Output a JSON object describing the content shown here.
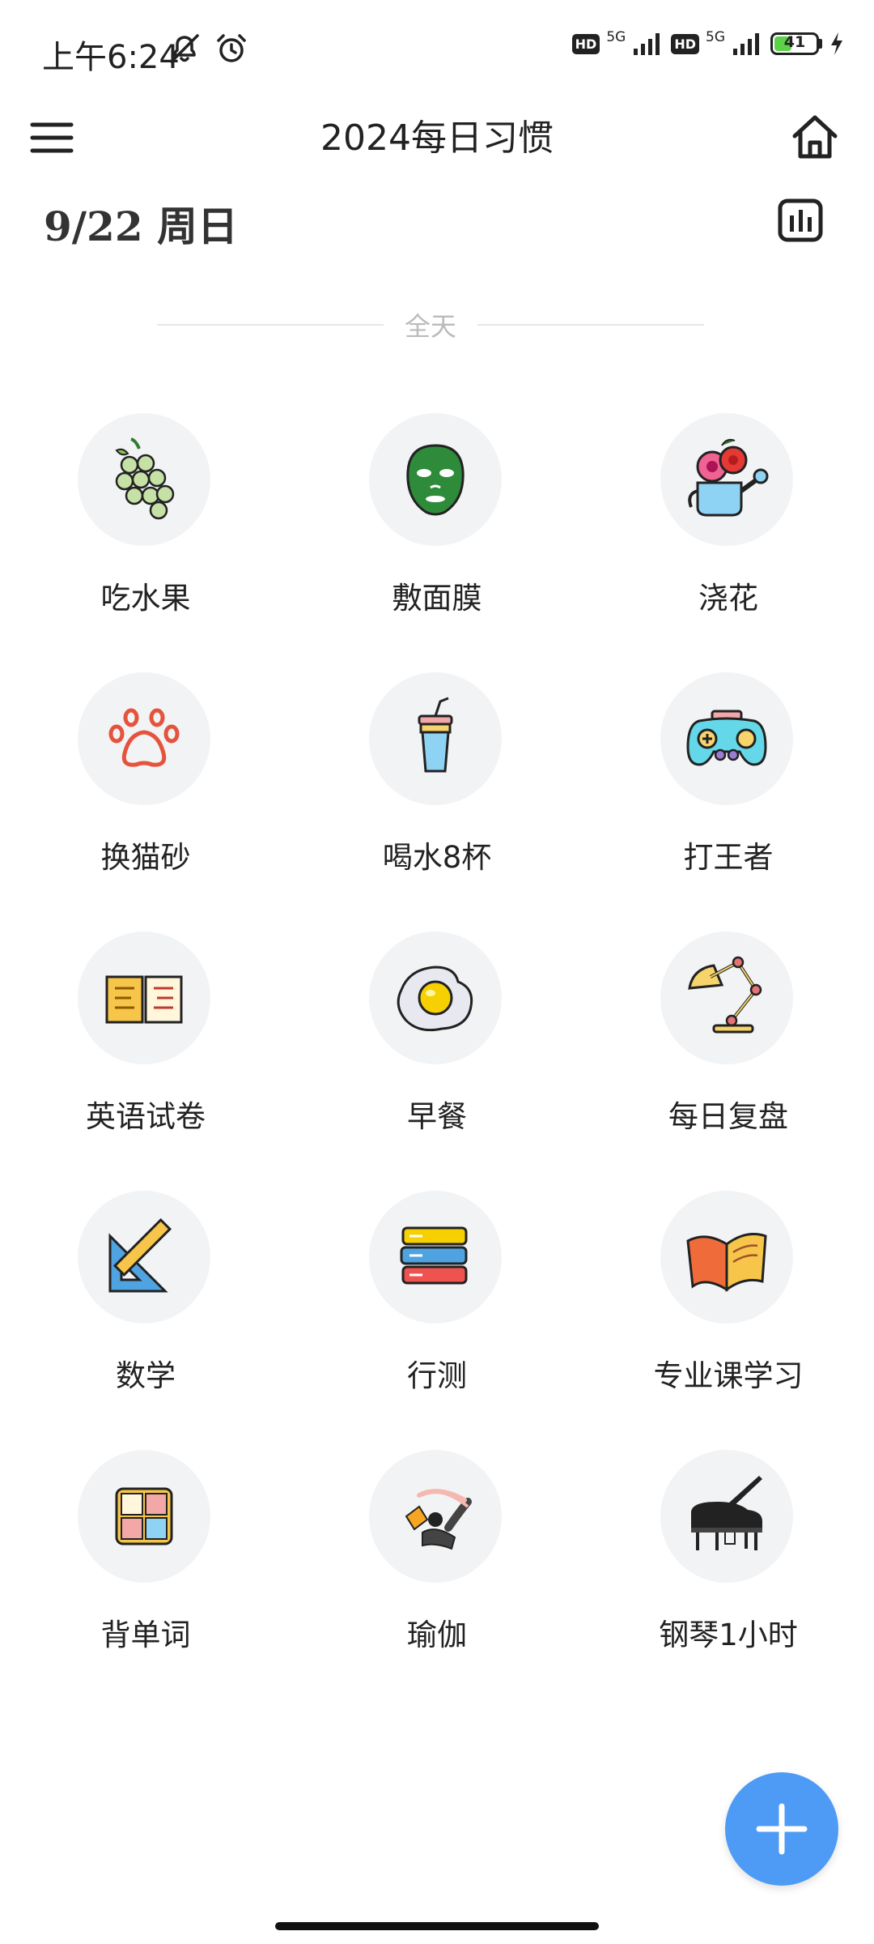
{
  "status_bar": {
    "time": "上午6:24",
    "network_1": "5G",
    "network_2": "5G",
    "hd_label": "HD",
    "battery_level": "41",
    "battery_fraction": 0.41,
    "icons": [
      "bell-off-icon",
      "alarm-icon",
      "signal-icon",
      "charging-icon"
    ]
  },
  "header": {
    "title": "2024每日习惯",
    "menu_icon": "hamburger-menu-icon",
    "home_icon": "home-icon"
  },
  "date_row": {
    "date": "9/22 周日",
    "stats_icon": "bar-chart-icon"
  },
  "section": {
    "label": "全天"
  },
  "habits": [
    {
      "label": "吃水果",
      "icon": "grapes-icon"
    },
    {
      "label": "敷面膜",
      "icon": "face-mask-icon"
    },
    {
      "label": "浇花",
      "icon": "watering-can-flowers-icon"
    },
    {
      "label": "换猫砂",
      "icon": "paw-print-icon"
    },
    {
      "label": "喝水8杯",
      "icon": "drink-cup-icon"
    },
    {
      "label": "打王者",
      "icon": "gamepad-icon"
    },
    {
      "label": "英语试卷",
      "icon": "open-book-icon"
    },
    {
      "label": "早餐",
      "icon": "fried-egg-icon"
    },
    {
      "label": "每日复盘",
      "icon": "desk-lamp-icon"
    },
    {
      "label": "数学",
      "icon": "triangle-ruler-icon"
    },
    {
      "label": "行测",
      "icon": "book-stack-icon"
    },
    {
      "label": "专业课学习",
      "icon": "open-textbook-icon"
    },
    {
      "label": "背单词",
      "icon": "abcd-blocks-icon"
    },
    {
      "label": "瑜伽",
      "icon": "yoga-pose-icon"
    },
    {
      "label": "钢琴1小时",
      "icon": "grand-piano-icon"
    }
  ],
  "fab": {
    "icon": "plus-icon"
  },
  "colors": {
    "fab": "#4d9bf5",
    "circle_bg": "#f2f3f5",
    "divider_text": "#bbbbbb"
  }
}
